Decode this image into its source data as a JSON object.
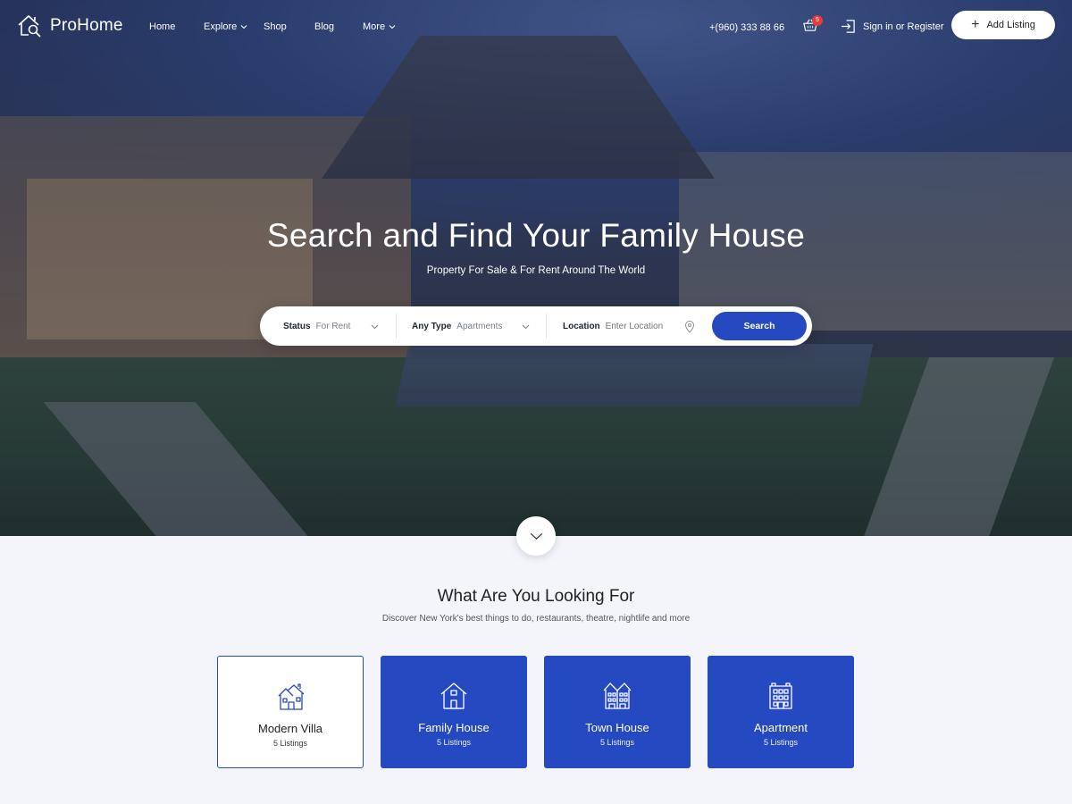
{
  "brand": {
    "name": "ProHome"
  },
  "nav": {
    "items": [
      {
        "label": "Home",
        "has_dropdown": false
      },
      {
        "label": "Explore",
        "has_dropdown": true
      },
      {
        "label": "Shop",
        "has_dropdown": false
      },
      {
        "label": "Blog",
        "has_dropdown": false
      },
      {
        "label": "More",
        "has_dropdown": true
      }
    ]
  },
  "header": {
    "phone": "+(960) 333 88 66",
    "cart_count": "5",
    "signin_label": "Sign in or Register",
    "add_listing_label": "Add Listing"
  },
  "hero": {
    "title": "Search and Find Your Family House",
    "subtitle": "Property For Sale & For Rent Around The World"
  },
  "search": {
    "status_label": "Status",
    "status_value": "For Rent",
    "type_label": "Any Type",
    "type_value": "Apartments",
    "location_label": "Location",
    "location_placeholder": "Enter Location",
    "button_label": "Search"
  },
  "section": {
    "title": "What Are You Looking For",
    "subtitle": "Discover New York's best things to do, restaurants, theatre, nightlife and more"
  },
  "categories": [
    {
      "name": "Modern Villa",
      "count": "5 Listings",
      "icon": "villa-icon",
      "active": true
    },
    {
      "name": "Family House",
      "count": "5 Listings",
      "icon": "house-icon",
      "active": false
    },
    {
      "name": "Town House",
      "count": "5 Listings",
      "icon": "townhouse-icon",
      "active": false
    },
    {
      "name": "Apartment",
      "count": "5 Listings",
      "icon": "apartment-icon",
      "active": false
    }
  ],
  "colors": {
    "accent": "#2549c1",
    "badge": "#e63b3b",
    "section_bg": "#f3f5fb"
  }
}
